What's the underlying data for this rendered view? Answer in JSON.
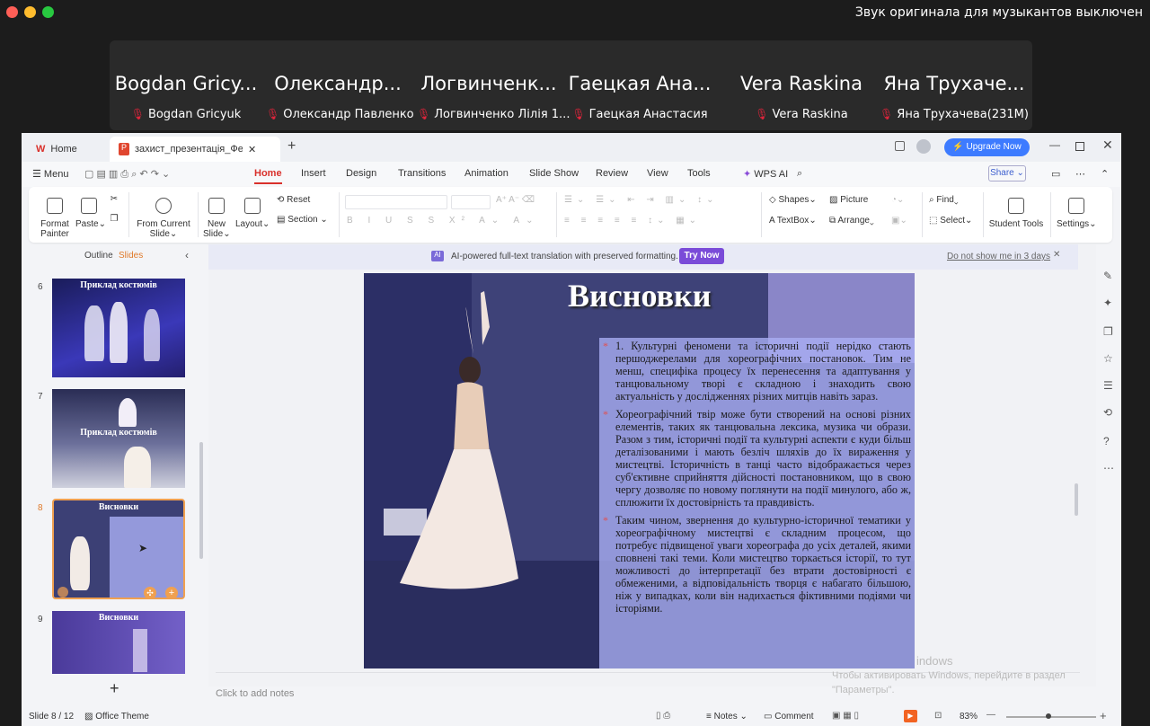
{
  "meeting": {
    "notice": "Звук оригинала для музыкантов выключен",
    "participants": [
      {
        "display": "Bogdan Gricy...",
        "name": "Bogdan Gricyuk"
      },
      {
        "display": "Олександр...",
        "name": "Олександр Павленко"
      },
      {
        "display": "Логвинченк...",
        "name": "Логвинченко Лілія 1..."
      },
      {
        "display": "Гаецкая Ана...",
        "name": "Гаецкая Анастасия"
      },
      {
        "display": "Vera Raskina",
        "name": "Vera Raskina"
      },
      {
        "display": "Яна Трухаче...",
        "name": "Яна Трухачева(231М)"
      }
    ]
  },
  "tabs": {
    "home": "Home",
    "doc": "захист_презентація_Федоров",
    "upgrade": "Upgrade Now"
  },
  "menu": {
    "menu": "Menu",
    "home": "Home",
    "insert": "Insert",
    "design": "Design",
    "transitions": "Transitions",
    "animation": "Animation",
    "slideshow": "Slide Show",
    "review": "Review",
    "view": "View",
    "tools": "Tools",
    "wpsai": "WPS AI",
    "share": "Share"
  },
  "ribbon": {
    "format_painter_1": "Format",
    "format_painter_2": "Painter",
    "paste": "Paste",
    "from_current_1": "From Current",
    "from_current_2": "Slide",
    "new_slide_1": "New",
    "new_slide_2": "Slide",
    "layout": "Layout",
    "reset": "Reset",
    "section": "Section",
    "shapes": "Shapes",
    "picture": "Picture",
    "textbox": "TextBox",
    "arrange": "Arrange",
    "find": "Find",
    "select": "Select",
    "student_tools": "Student Tools",
    "settings": "Settings"
  },
  "left_pane": {
    "outline": "Outline",
    "slides": "Slides",
    "thumbs": [
      {
        "num": "6",
        "title": "Приклад костюмів"
      },
      {
        "num": "7",
        "title": "Приклад костюмів"
      },
      {
        "num": "8",
        "title": "Висновки"
      },
      {
        "num": "9",
        "title": "Висновки"
      }
    ]
  },
  "banner": {
    "text": "AI-powered full-text translation with preserved formatting.",
    "try": "Try Now",
    "dismiss": "Do not show me in 3 days"
  },
  "slide": {
    "title": "Висновки",
    "bullets": [
      "1. Культурні феномени та історичні події нерідко стають першоджерелами для хореографічних постановок. Тим не менш, специфіка процесу їх перенесення та адаптування у танцювальному творі є складною і знаходить свою актуальність у дослідженнях різних митців навіть зараз.",
      "Хореографічний твір може бути створений на основі різних елементів, таких як танцювальна лексика, музика чи образи. Разом з тим, історичні події та культурні аспекти є куди більш деталізованими і мають безліч шляхів до їх вираження у мистецтві. Історичність в танці часто відображається через суб'єктивне сприйняття дійсності постановником, що в свою чергу дозволяє по новому поглянути на події минулого, або ж, сплюжити їх достовірність та правдивість.",
      "Таким чином, звернення до культурно-історичної тематики у хореографічному мистецтві є складним процесом, що потребує підвищеної уваги хореографа до усіх деталей, якими сповнені такі теми. Коли мистецтво торкається історії, то тут можливості до інтерпретації без втрати достовірності є обмеженими, а відповідальність творця є набагато більшою, ніж у випадках, коли він надихається фіктивними подіями чи історіями."
    ]
  },
  "notes_placeholder": "Click to add notes",
  "watermark": {
    "line1": "indows",
    "line2": "Чтобы активировать Windows, перейдите в раздел",
    "line3": "\"Параметры\"."
  },
  "status": {
    "slide": "Slide 8 / 12",
    "theme": "Office Theme",
    "notes": "Notes",
    "comment": "Comment",
    "zoom": "83%"
  },
  "colors": {
    "accent": "#d9302b",
    "upgrade": "#3d7bff",
    "try_now": "#7a4bd8"
  }
}
